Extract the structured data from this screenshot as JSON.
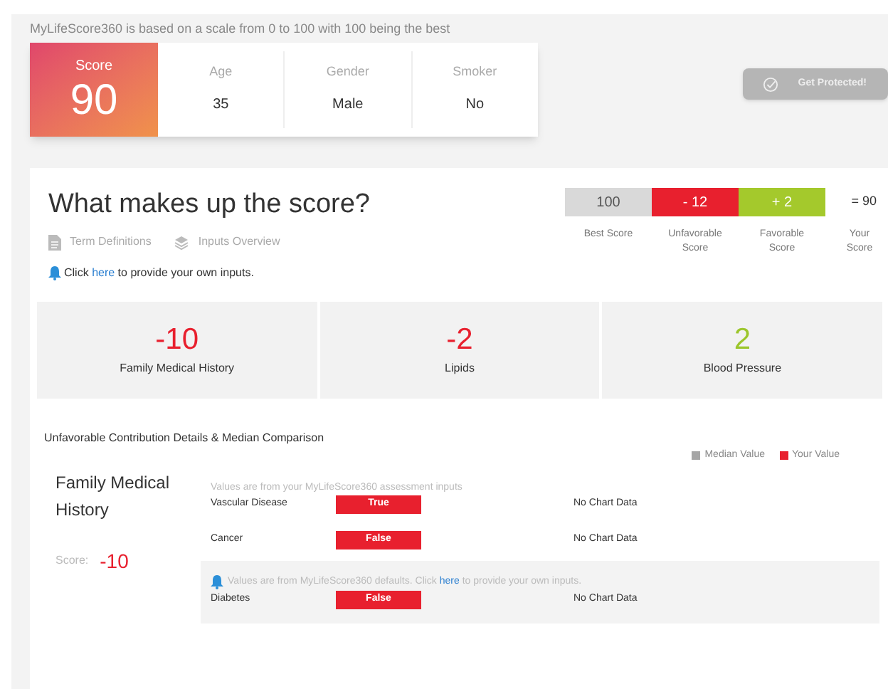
{
  "info_text": "MyLifeScore360 is based on a scale from 0 to 100 with 100 being the best",
  "score_card": {
    "label": "Score",
    "value": "90",
    "fields": [
      {
        "label": "Age",
        "value": "35"
      },
      {
        "label": "Gender",
        "value": "Male"
      },
      {
        "label": "Smoker",
        "value": "No"
      }
    ]
  },
  "cta_button": {
    "label": "Get Protected!",
    "disabled": true
  },
  "breakdown": {
    "title": "What makes up the score?",
    "links": [
      {
        "label": "Term Definitions",
        "kind": "document"
      },
      {
        "label": "Inputs Overview",
        "kind": "layers"
      }
    ],
    "notice": {
      "before": "Click ",
      "link": "here",
      "after": " to provide your own inputs."
    },
    "segments": [
      {
        "value": "100",
        "label": "Best Score",
        "color": "#d9d9d9"
      },
      {
        "value": "- 12",
        "label": "Unfavorable Score",
        "color": "#e8202e"
      },
      {
        "value": "+ 2",
        "label": "Favorable Score",
        "color": "#a4c92c"
      }
    ],
    "total": {
      "value": "= 90",
      "label": "Your Score"
    }
  },
  "categories": [
    {
      "value": "-10",
      "label": "Family Medical History",
      "kind": "unfavorable"
    },
    {
      "value": "-2",
      "label": "Lipids",
      "kind": "unfavorable"
    },
    {
      "value": "2",
      "label": "Blood Pressure",
      "kind": "favorable"
    }
  ],
  "details": {
    "title": "Unfavorable Contribution Details & Median Comparison",
    "legend": [
      {
        "label": "Median Value",
        "color": "#a6a6a6"
      },
      {
        "label": "Your Value",
        "color": "#e8202e"
      }
    ],
    "section": {
      "title": "Family Medical History",
      "score_label": "Score:",
      "score": "-10",
      "groups": [
        {
          "kind": "assessment",
          "note": "Values are from your MyLifeScore360 assessment inputs",
          "rows": [
            {
              "name": "Vascular Disease",
              "value": "True",
              "chart": "No Chart Data"
            },
            {
              "name": "Cancer",
              "value": "False",
              "chart": "No Chart Data"
            }
          ]
        },
        {
          "kind": "defaults",
          "note": {
            "before": "Values are from MyLifeScore360 defaults. Click ",
            "link": "here",
            "after": " to provide your own inputs."
          },
          "rows": [
            {
              "name": "Diabetes",
              "value": "False",
              "chart": "No Chart Data"
            }
          ]
        }
      ]
    }
  }
}
